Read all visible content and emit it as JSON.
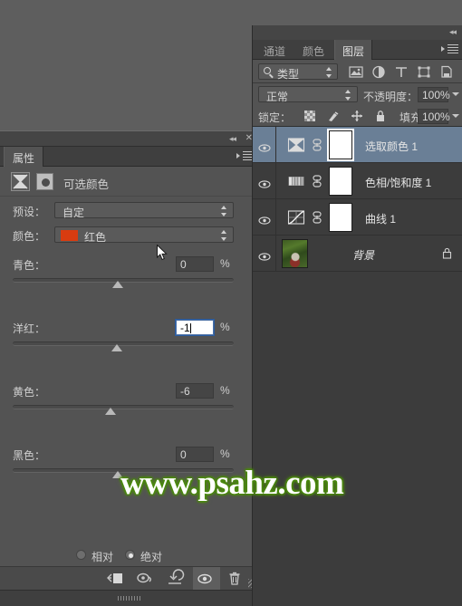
{
  "app": {
    "background_color": "#5e5e5e"
  },
  "properties_panel": {
    "tab_label": "属性",
    "collapse_icon": "double-chevron-left-icon",
    "close_icon": "close-icon",
    "menu_icon": "panel-menu-icon",
    "adjustment_icon": "selective-color-adjustment-icon",
    "mask_thumbnail_icon": "layer-mask-thumbnail",
    "title": "可选颜色",
    "fields": [
      {
        "label": "预设：",
        "value": "自定",
        "name": "preset"
      },
      {
        "label": "颜色：",
        "value": "红色",
        "name": "color",
        "swatch": "#d83c10"
      }
    ],
    "sliders": [
      {
        "label": "青色：",
        "value": "0",
        "unit": "%",
        "pos": 50.0,
        "editing": false
      },
      {
        "label": "洋红：",
        "value": "-1",
        "unit": "%",
        "pos": 49.5,
        "editing": true
      },
      {
        "label": "黄色：",
        "value": "-6",
        "unit": "%",
        "pos": 47.0,
        "editing": false
      },
      {
        "label": "黑色：",
        "value": "0",
        "unit": "%",
        "pos": 50.0,
        "editing": false
      }
    ],
    "radios": [
      {
        "label": "相对",
        "selected": false
      },
      {
        "label": "绝对",
        "selected": true
      }
    ],
    "footer_buttons": [
      {
        "name": "clip-to-layer-icon",
        "active": false
      },
      {
        "name": "toggle-previous-state-icon",
        "active": false
      },
      {
        "name": "reset-icon",
        "active": false
      },
      {
        "name": "toggle-visibility-icon",
        "active": true
      },
      {
        "name": "delete-icon",
        "active": false
      }
    ]
  },
  "layers_panel": {
    "collapse_icon": "double-chevron-left-icon",
    "tabs": [
      {
        "label": "通道",
        "active": false
      },
      {
        "label": "颜色",
        "active": false
      },
      {
        "label": "图层",
        "active": true
      }
    ],
    "menu_icon": "panel-menu-icon",
    "filter": {
      "search_icon": "search-icon",
      "kind_label": "类型",
      "icons": [
        "filter-pixel-layers-icon",
        "filter-adjustment-layers-icon",
        "filter-type-layers-icon",
        "filter-shape-layers-icon",
        "filter-smart-objects-icon"
      ]
    },
    "blend": {
      "mode": "正常",
      "opacity_label": "不透明度：",
      "opacity_value": "100%"
    },
    "lock": {
      "label": "锁定：",
      "icons": [
        "lock-transparent-pixels-icon",
        "lock-image-pixels-icon",
        "lock-position-icon",
        "lock-all-icon"
      ],
      "fill_label": "填充：",
      "fill_value": "100%"
    },
    "layers": [
      {
        "name": "选取颜色 1",
        "selected": true,
        "visible": true,
        "adjustment_icon": "selective-color-adjustment-icon",
        "link_icon": "mask-link-icon",
        "has_mask": true,
        "locked": false,
        "italic": false
      },
      {
        "name": "色相/饱和度 1",
        "selected": false,
        "visible": true,
        "adjustment_icon": "hue-saturation-adjustment-icon",
        "link_icon": "mask-link-icon",
        "has_mask": true,
        "locked": false,
        "italic": false
      },
      {
        "name": "曲线 1",
        "selected": false,
        "visible": true,
        "adjustment_icon": "curves-adjustment-icon",
        "link_icon": "mask-link-icon",
        "has_mask": true,
        "locked": false,
        "italic": false
      },
      {
        "name": "背景",
        "selected": false,
        "visible": true,
        "adjustment_icon": "",
        "link_icon": "",
        "has_mask": false,
        "locked": true,
        "italic": true,
        "lock_icon": "lock-icon"
      }
    ]
  },
  "watermark": {
    "text": "www.psahz.com",
    "color": "#ffffff",
    "glow_color": "#4a8a0c"
  },
  "cursor": {
    "name": "mouse-pointer-icon"
  }
}
